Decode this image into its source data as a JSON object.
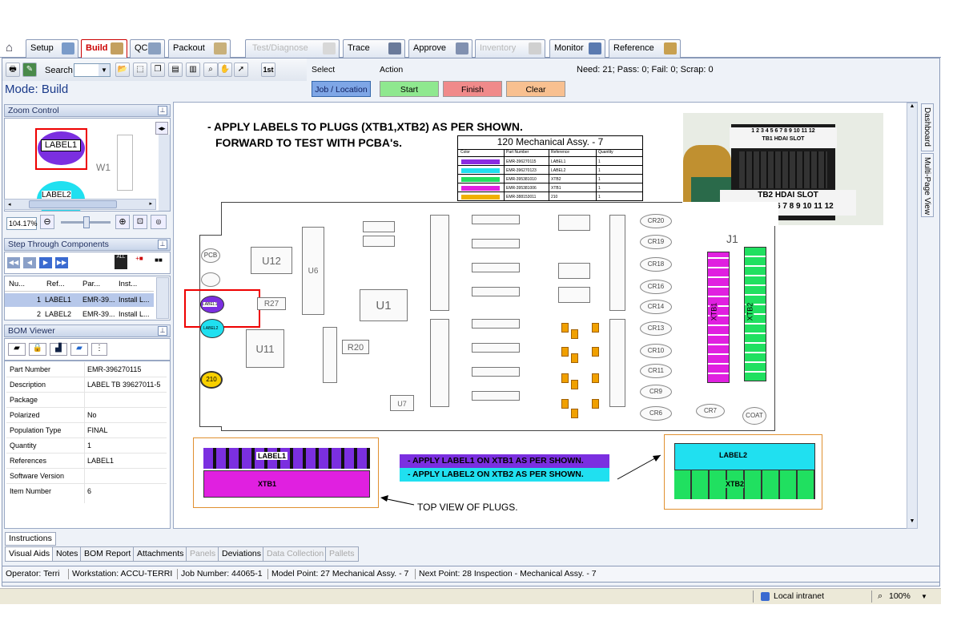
{
  "tabs": [
    {
      "label": "Setup",
      "state": "normal"
    },
    {
      "label": "Build",
      "state": "active"
    },
    {
      "label": "QC",
      "state": "normal"
    },
    {
      "label": "Packout",
      "state": "normal"
    },
    {
      "label": "Test/Diagnose",
      "state": "disabled"
    },
    {
      "label": "Trace",
      "state": "normal"
    },
    {
      "label": "Approve",
      "state": "normal"
    },
    {
      "label": "Inventory",
      "state": "disabled"
    },
    {
      "label": "Monitor",
      "state": "normal"
    },
    {
      "label": "Reference",
      "state": "normal"
    }
  ],
  "toolbar": {
    "search_label": "Search",
    "first_label": "1st"
  },
  "mode": {
    "label": "Mode: Build"
  },
  "select": {
    "header": "Select",
    "job_button": "Job / Location"
  },
  "action": {
    "header": "Action",
    "start": "Start",
    "finish": "Finish",
    "clear": "Clear"
  },
  "stats": {
    "text": "Need: 21; Pass: 0; Fail: 0; Scrap: 0"
  },
  "zoom": {
    "title": "Zoom Control",
    "value": "104.17%",
    "label1": "LABEL1",
    "label2": "LABEL2",
    "w1": "W1"
  },
  "step": {
    "title": "Step Through Components",
    "columns": [
      "Nu...",
      "Ref...",
      "Par...",
      "Inst..."
    ],
    "rows": [
      {
        "num": "1",
        "ref": "LABEL1",
        "part": "EMR-39...",
        "inst": "Install L..."
      },
      {
        "num": "2",
        "ref": "LABEL2",
        "part": "EMR-39...",
        "inst": "Install L..."
      }
    ]
  },
  "bom": {
    "title": "BOM Viewer",
    "rows": [
      {
        "k": "Part Number",
        "v": "EMR-396270115"
      },
      {
        "k": "Description",
        "v": "LABEL TB 39627011-5"
      },
      {
        "k": "Package",
        "v": ""
      },
      {
        "k": "Polarized",
        "v": "No"
      },
      {
        "k": "Population Type",
        "v": "FINAL"
      },
      {
        "k": "Quantity",
        "v": "1"
      },
      {
        "k": "References",
        "v": "LABEL1"
      },
      {
        "k": "Software Version",
        "v": ""
      },
      {
        "k": "Item Number",
        "v": "6"
      }
    ]
  },
  "side_tabs": {
    "dashboard": "Dashboard",
    "multipage": "Multi-Page View"
  },
  "instructions_tab": "Instructions",
  "bottom_tabs": [
    {
      "label": "Visual Aids",
      "state": "active"
    },
    {
      "label": "Notes",
      "state": "normal"
    },
    {
      "label": "BOM Report",
      "state": "normal"
    },
    {
      "label": "Attachments",
      "state": "normal"
    },
    {
      "label": "Panels",
      "state": "disabled"
    },
    {
      "label": "Deviations",
      "state": "normal"
    },
    {
      "label": "Data Collection",
      "state": "disabled"
    },
    {
      "label": "Pallets",
      "state": "disabled"
    }
  ],
  "status_bar": {
    "operator": "Operator:  Terri",
    "workstation": "Workstation:  ACCU-TERRI",
    "job": "Job Number:  44065-1",
    "model": "Model Point:  27  Mechanical Assy. - 7",
    "next": "Next Point:  28  Inspection - Mechanical Assy. - 7"
  },
  "browser": {
    "zone": "Local intranet",
    "zoom": "100%"
  },
  "doc": {
    "line1": "- APPLY LABELS TO  PLUGS (XTB1,XTB2) AS PER SHOWN.",
    "line2": "FORWARD TO TEST WITH PCBA's.",
    "table_title": "120  Mechanical Assy. - 7",
    "table_cols": [
      "Color",
      "Part Number",
      "Reference",
      "Quantity"
    ],
    "table_rows": [
      {
        "color": "#8a2be2",
        "part": "EMR-396270115",
        "ref": "LABEL1",
        "qty": "1"
      },
      {
        "color": "#20e0f0",
        "part": "EMR-396270123",
        "ref": "LABEL2",
        "qty": "1"
      },
      {
        "color": "#20e060",
        "part": "EMR-395381010",
        "ref": "XTB2",
        "qty": "1"
      },
      {
        "color": "#e020e0",
        "part": "EMR-395381006",
        "ref": "XTB1",
        "qty": "1"
      },
      {
        "color": "#f0b000",
        "part": "EMR-388153011",
        "ref": "210",
        "qty": "1"
      }
    ],
    "photo_top_nums": "1 2 3 4 5 6 7 8 9 10 11 12",
    "photo_top_labels": "TB1      HDAI      SLOT",
    "photo_bot_labels": "TB2      HDAI      SLOT",
    "photo_bot_nums": "1 2 3 4 5 6 7 8 9 10 11 12",
    "j1": "J1",
    "xtb1": "XTB1",
    "xtb2": "XTB2",
    "u12": "U12",
    "u6": "U6",
    "u1": "U1",
    "u11": "U11",
    "u7": "U7",
    "r20": "R20",
    "r27": "R27",
    "pcb": "PCB",
    "label1_small": "LABEL1",
    "label2_small": "LABEL2",
    "part210": "210",
    "cr_labels": [
      "CR20",
      "CR19",
      "CR18",
      "CR16",
      "CR14",
      "CR13",
      "CR10",
      "CR11",
      "CR9",
      "CR6"
    ],
    "cr7": "CR7",
    "coat": "COAT",
    "note1": "- APPLY LABEL1 ON XTB1 AS PER SHOWN.",
    "note2": "- APPLY LABEL2 ON XTB2 AS PER SHOWN.",
    "top_view": "TOP VIEW OF PLUGS.",
    "plug_label1": "LABEL1",
    "plug_xtb1": "XTB1",
    "plug_label2": "LABEL2",
    "plug_xtb2": "XTB2"
  }
}
